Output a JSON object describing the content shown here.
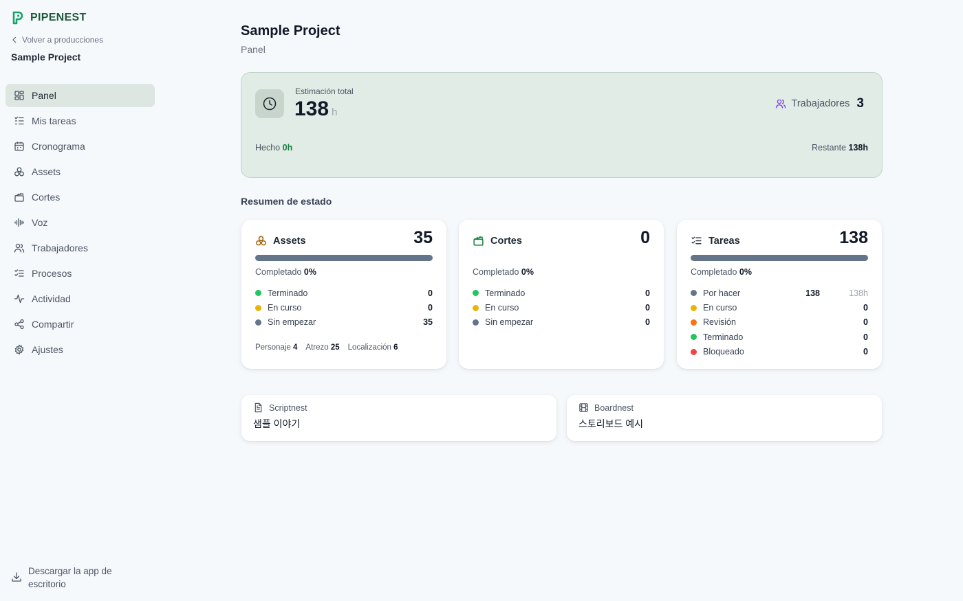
{
  "brand": {
    "name": "PIPENEST",
    "color": "#1d5a3a"
  },
  "sidebar": {
    "back_label": "Volver a producciones",
    "project_name": "Sample Project",
    "items": [
      {
        "label": "Panel",
        "icon": "dashboard-icon",
        "active": true
      },
      {
        "label": "Mis tareas",
        "icon": "task-list-icon"
      },
      {
        "label": "Cronograma",
        "icon": "calendar-icon"
      },
      {
        "label": "Assets",
        "icon": "boxes-icon"
      },
      {
        "label": "Cortes",
        "icon": "clapperboard-icon"
      },
      {
        "label": "Voz",
        "icon": "audio-wave-icon"
      },
      {
        "label": "Trabajadores",
        "icon": "users-icon"
      },
      {
        "label": "Procesos",
        "icon": "checklist-icon"
      },
      {
        "label": "Actividad",
        "icon": "activity-icon"
      },
      {
        "label": "Compartir",
        "icon": "share-icon"
      },
      {
        "label": "Ajustes",
        "icon": "settings-icon"
      }
    ],
    "download_line1": "Descargar la app de",
    "download_line2": "escritorio"
  },
  "header": {
    "title": "Sample Project",
    "subtitle": "Panel"
  },
  "estimate": {
    "label": "Estimación total",
    "value": "138",
    "unit": "h",
    "workers_label": "Trabajadores",
    "workers_count": "3",
    "done_label": "Hecho",
    "done_value": "0h",
    "remaining_label": "Restante",
    "remaining_value": "138h"
  },
  "summary": {
    "title": "Resumen de estado",
    "completed_label": "Completado",
    "assets": {
      "title": "Assets",
      "count": "35",
      "completed": "0%",
      "progress": 0,
      "statuses": [
        {
          "label": "Terminado",
          "value": "0",
          "color": "#22c55e"
        },
        {
          "label": "En curso",
          "value": "0",
          "color": "#eab308"
        },
        {
          "label": "Sin empezar",
          "value": "35",
          "color": "#64748b"
        }
      ],
      "types": [
        {
          "label": "Personaje",
          "value": "4"
        },
        {
          "label": "Atrezo",
          "value": "25"
        },
        {
          "label": "Localización",
          "value": "6"
        }
      ]
    },
    "cortes": {
      "title": "Cortes",
      "count": "0",
      "completed": "0%",
      "progress": 0,
      "statuses": [
        {
          "label": "Terminado",
          "value": "0",
          "color": "#22c55e"
        },
        {
          "label": "En curso",
          "value": "0",
          "color": "#eab308"
        },
        {
          "label": "Sin empezar",
          "value": "0",
          "color": "#64748b"
        }
      ]
    },
    "tareas": {
      "title": "Tareas",
      "count": "138",
      "completed": "0%",
      "progress": 0,
      "statuses": [
        {
          "label": "Por hacer",
          "value": "138",
          "hours": "138h",
          "color": "#64748b"
        },
        {
          "label": "En curso",
          "value": "0",
          "color": "#eab308"
        },
        {
          "label": "Revisión",
          "value": "0",
          "color": "#f97316"
        },
        {
          "label": "Terminado",
          "value": "0",
          "color": "#22c55e"
        },
        {
          "label": "Bloqueado",
          "value": "0",
          "color": "#ef4444"
        }
      ]
    }
  },
  "links": {
    "scriptnest": {
      "label": "Scriptnest",
      "value": "샘플 이야기"
    },
    "boardnest": {
      "label": "Boardnest",
      "value": "스토리보드 예시"
    }
  }
}
